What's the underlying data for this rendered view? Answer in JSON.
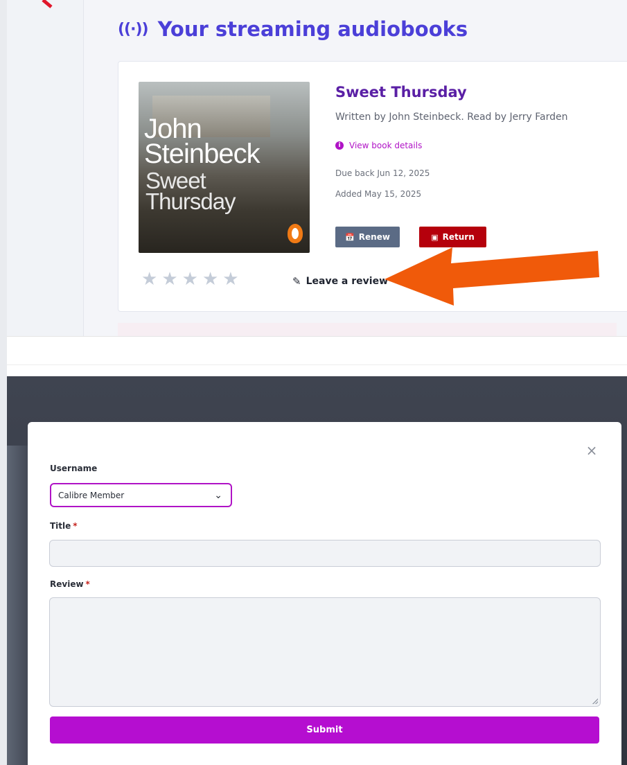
{
  "colors": {
    "heading": "#4b3fd8",
    "book_title": "#5a1fa5",
    "accent": "#b013c6",
    "renew": "#5b6b85",
    "return": "#b5000c",
    "submit": "#b50ed0",
    "arrow": "#f05a0a"
  },
  "header": {
    "icon": "broadcast-icon",
    "icon_glyph": "((·))",
    "title": "Your streaming audiobooks"
  },
  "book": {
    "cover_author": "John Steinbeck",
    "cover_author_line1": "John",
    "cover_author_line2": "Steinbeck",
    "cover_title_line1": "Sweet",
    "cover_title_line2": "Thursday",
    "title": "Sweet Thursday",
    "credit": "Written by John Steinbeck. Read by Jerry Farden",
    "details_link": "View book details",
    "due": "Due back Jun 12, 2025",
    "added": "Added May 15, 2025",
    "renew_label": "Renew",
    "return_label": "Return",
    "rating": {
      "value": 0,
      "max": 5
    },
    "review_link": "Leave a review"
  },
  "modal": {
    "close_glyph": "×",
    "username_label": "Username",
    "username_value": "Calibre Member",
    "title_label": "Title",
    "title_value": "",
    "review_label": "Review",
    "review_value": "",
    "required_marker": "*",
    "submit_label": "Submit"
  }
}
